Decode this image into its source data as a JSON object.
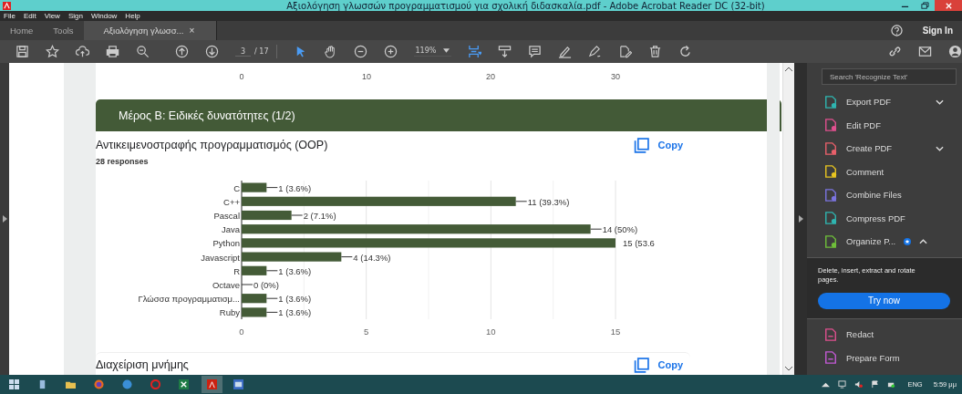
{
  "window": {
    "title": "Αξιολόγηση γλωσσών προγραμματισμού για σχολική διδασκαλία.pdf - Adobe Acrobat Reader DC (32-bit)"
  },
  "menu": [
    "File",
    "Edit",
    "View",
    "Sign",
    "Window",
    "Help"
  ],
  "tabs": [
    {
      "label": "Home",
      "selected": false
    },
    {
      "label": "Tools",
      "selected": false
    },
    {
      "label": "Αξιολόγηση γλωσσ...",
      "selected": true,
      "close": "×"
    }
  ],
  "help": {
    "label": "Sign In"
  },
  "toolbar": {
    "page": "3",
    "page_total": "/ 17",
    "zoom": "119%"
  },
  "prev_axis": [
    "0",
    "10",
    "20",
    "30"
  ],
  "section": {
    "title": "Μέρος Β: Ειδικές δυνατότητες (1/2)"
  },
  "question": {
    "title": "Αντικειμενοστραφής προγραμματισμός (OOP)",
    "copy": "Copy",
    "responses": "28 responses",
    "chart_data": {
      "type": "bar",
      "orientation": "horizontal",
      "categories": [
        "C",
        "C++",
        "Pascal",
        "Java",
        "Python",
        "Javascript",
        "R",
        "Octave",
        "Γλώσσα προγραμματισμ...",
        "Ruby"
      ],
      "values": [
        1,
        11,
        2,
        14,
        15,
        4,
        1,
        0,
        1,
        1
      ],
      "value_labels": [
        "1 (3.6%)",
        "11 (39.3%)",
        "2 (7.1%)",
        "14 (50%)",
        "15 (53.6",
        "4 (14.3%)",
        "1 (3.6%)",
        "0 (0%)",
        "1 (3.6%)",
        "1 (3.6%)"
      ],
      "xlim": [
        0,
        15
      ],
      "xticks": [
        0,
        5,
        10,
        15
      ]
    }
  },
  "next_question": {
    "title": "Διαχείριση μνήμης",
    "copy": "Copy"
  },
  "tools_panel": {
    "search": {
      "placeholder": "Search 'Recognize Text'"
    },
    "tools": [
      {
        "label": "Export PDF",
        "color": "#2fb5b0",
        "dropdown": true,
        "expanded": false,
        "badge": false
      },
      {
        "label": "Edit PDF",
        "color": "#e0508f",
        "dropdown": false,
        "expanded": false,
        "badge": false
      },
      {
        "label": "Create PDF",
        "color": "#e8606a",
        "dropdown": true,
        "expanded": false,
        "badge": false
      },
      {
        "label": "Comment",
        "color": "#e8c520",
        "dropdown": false,
        "expanded": false,
        "badge": false
      },
      {
        "label": "Combine Files",
        "color": "#7b74e0",
        "dropdown": false,
        "expanded": false,
        "badge": false
      },
      {
        "label": "Compress PDF",
        "color": "#2fb5b0",
        "dropdown": false,
        "expanded": false,
        "badge": false
      },
      {
        "label": "Organize P...",
        "color": "#6fbf3a",
        "dropdown": true,
        "expanded": true,
        "badge": true
      }
    ],
    "promo": {
      "text": "Delete, insert, extract and rotate pages.",
      "button": "Try now"
    },
    "more_tools": [
      {
        "label": "Redact",
        "color": "#e0508f"
      },
      {
        "label": "Prepare Form",
        "color": "#c45ad6"
      }
    ]
  },
  "taskbar": {
    "language": "ENG",
    "time": "5:59 μμ"
  }
}
